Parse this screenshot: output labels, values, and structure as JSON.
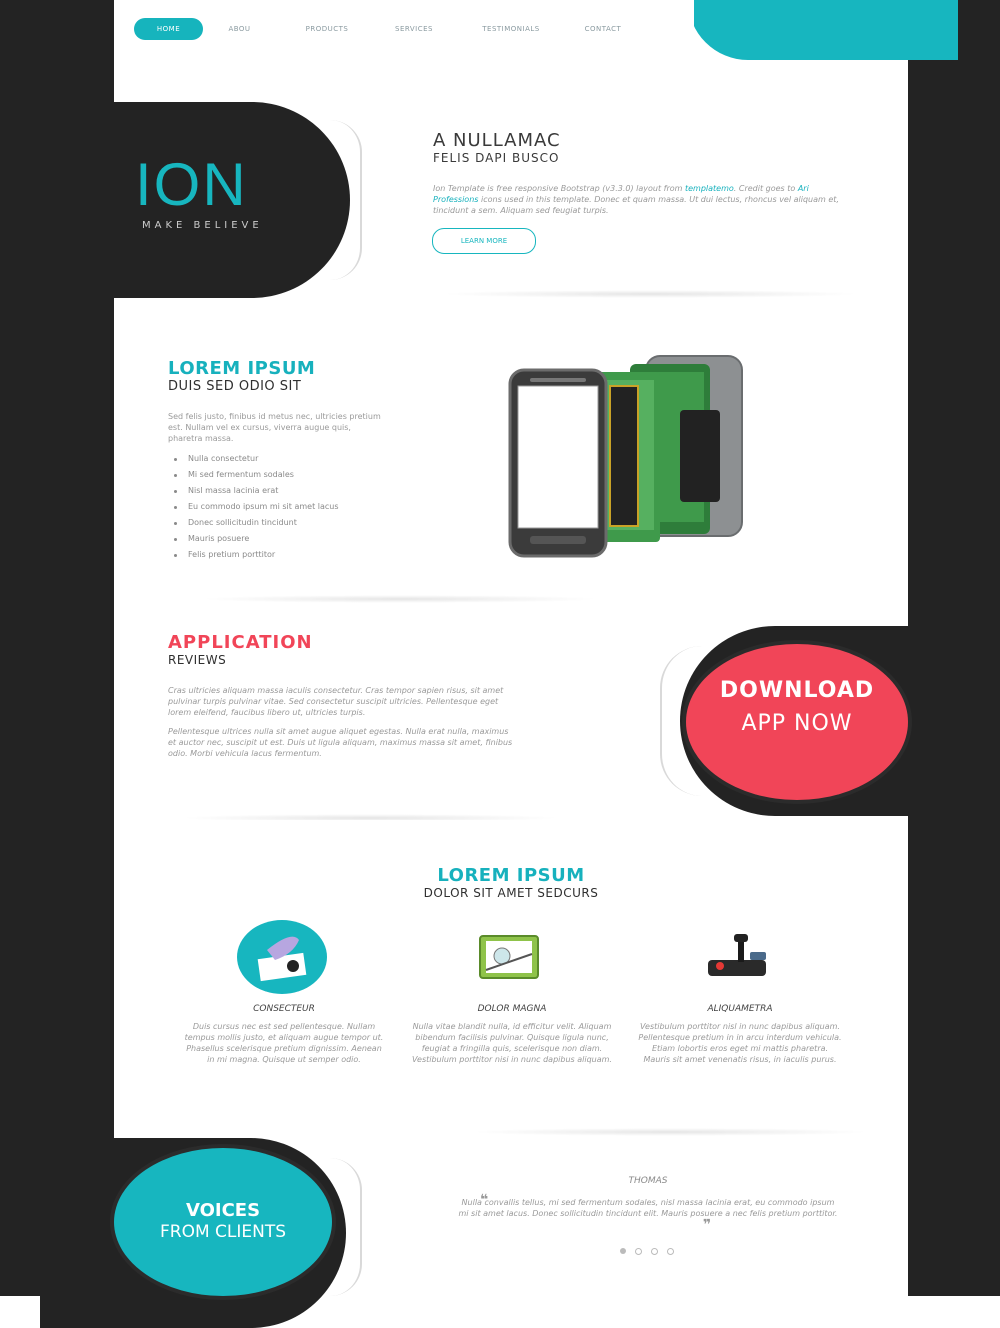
{
  "nav": {
    "items": [
      "HOME",
      "ABOU",
      "PRODUCTS",
      "SERVICES",
      "TESTIMONIALS",
      "CONTACT"
    ]
  },
  "hero": {
    "logo": "ION",
    "tagline": "MAKE BELIEVE",
    "title": "A NULLAMAC",
    "subtitle": "FELIS DAPI BUSCO",
    "body_1": "Ion Template is free responsive Bootstrap (v3.3.0) layout from ",
    "link_1": "templatemo",
    "body_2": ". Credit goes to ",
    "link_2": "Ari Professions",
    "body_3": " icons used in this template. Donec et quam massa. Ut dui lectus, rhoncus vel aliquam et, tincidunt a sem. Aliquam sed feugiat turpis.",
    "button": "LEARN MORE"
  },
  "lorem": {
    "title": "LOREM IPSUM",
    "subtitle": "DUIS SED ODIO SIT",
    "body": "Sed felis justo, finibus id metus nec, ultricies pretium est. Nullam vel ex cursus, viverra augue quis, pharetra massa.",
    "list": [
      "Nulla consectetur",
      "Mi sed fermentum sodales",
      "Nisl massa lacinia erat",
      "Eu commodo ipsum mi sit amet lacus",
      "Donec sollicitudin tincidunt",
      "Mauris posuere",
      "Felis pretium porttitor"
    ]
  },
  "reviews": {
    "title": "APPLICATION",
    "subtitle": "REVIEWS",
    "para_1": "Cras ultricies aliquam massa iaculis consectetur. Cras tempor sapien risus, sit amet pulvinar turpis pulvinar vitae. Sed consectetur suscipit ultricies. Pellentesque eget lorem eleifend, faucibus libero ut, ultricies turpis.",
    "para_2": "Pellentesque ultrices nulla sit amet augue aliquet egestas. Nulla erat nulla, maximus et auctor nec, suscipit ut est. Duis ut ligula aliquam, maximus massa sit amet, finibus odio. Morbi vehicula lacus fermentum.",
    "download_line_1": "DOWNLOAD",
    "download_line_2": "APP NOW"
  },
  "features": {
    "title": "LOREM IPSUM",
    "subtitle": "DOLOR SIT AMET SEDCURS",
    "items": [
      {
        "title": "CONSECTEUR",
        "body": "Duis cursus nec est sed pellentesque. Nullam tempus mollis justo, et aliquam augue tempor ut. Phasellus scelerisque pretium dignissim. Aenean in mi magna. Quisque ut semper odio.",
        "icon": "quill-pen-icon"
      },
      {
        "title": "DOLOR MAGNA",
        "body": "Nulla vitae blandit nulla, id efficitur velit. Aliquam bibendum facilisis pulvinar. Quisque ligula nunc, feugiat a fringilla quis, scelerisque non diam. Vestibulum porttitor nisi in nunc dapibus aliquam.",
        "icon": "chart-screen-icon"
      },
      {
        "title": "ALIQUAMETRA",
        "body": "Vestibulum porttitor nisl in nunc dapibus aliquam. Pellentesque pretium in in arcu interdum vehicula. Etiam lobortis eros eget mi mattis pharetra. Mauris sit amet venenatis risus, in iaculis purus.",
        "icon": "joystick-icon"
      }
    ]
  },
  "testimonials": {
    "line_1": "VOICES",
    "line_2": "FROM CLIENTS",
    "name": "THOMAS",
    "quote": "Nulla convallis tellus, mi sed fermentum sodales, nisl massa lacinia erat, eu commodo ipsum mi sit amet lacus. Donec sollicitudin tincidunt elit. Mauris posuere a nec felis pretium porttitor."
  },
  "colors": {
    "teal": "#17b6bf",
    "coral": "#f14558",
    "dark": "#232323"
  }
}
